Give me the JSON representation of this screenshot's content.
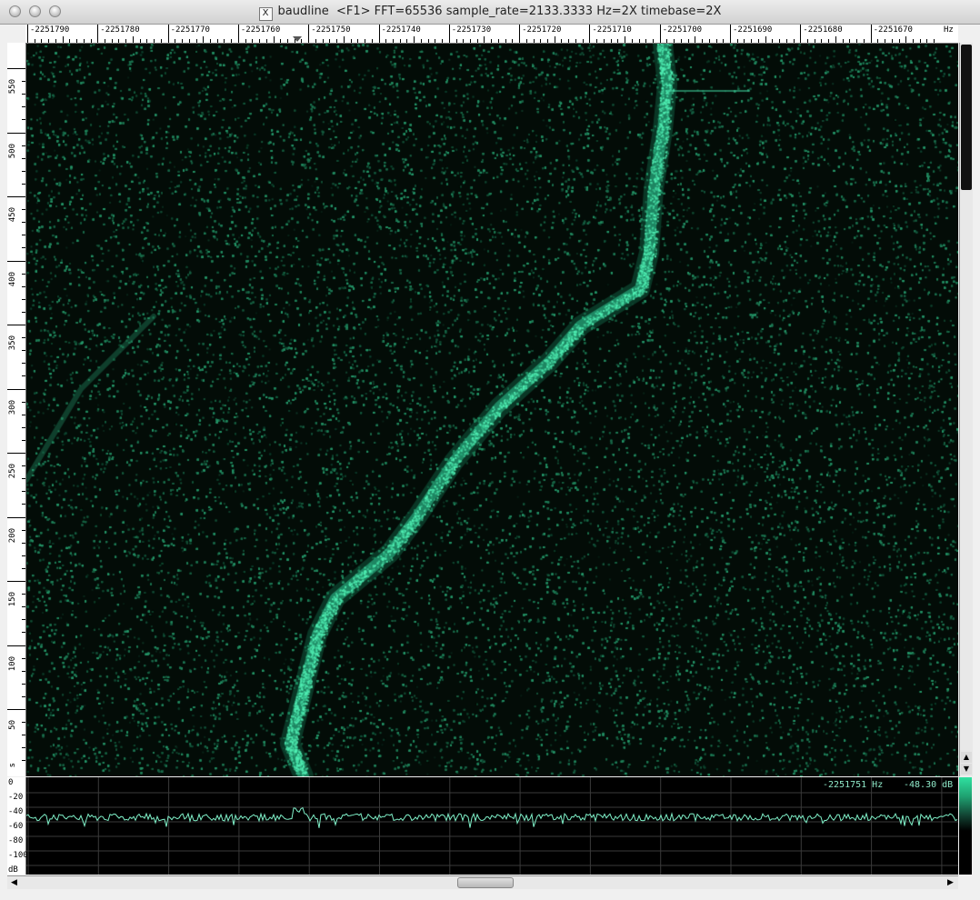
{
  "window": {
    "app_name": "baudline",
    "title_info": "<F1> FFT=65536 sample_rate=2133.3333 Hz=2X timebase=2X",
    "icon": "x11-icon"
  },
  "frequency_axis": {
    "unit": "Hz",
    "labels": [
      "-2251790",
      "-2251780",
      "-2251770",
      "-2251760",
      "-2251750",
      "-2251740",
      "-2251730",
      "-2251720",
      "-2251710",
      "-2251700",
      "-2251690",
      "-2251680",
      "-2251670"
    ]
  },
  "time_axis": {
    "labels": [
      "550",
      "500",
      "450",
      "400",
      "350",
      "300",
      "250",
      "200",
      "150",
      "100",
      "50"
    ],
    "unit_label": "s"
  },
  "spectrum": {
    "db_labels": [
      "0",
      "-20",
      "-40",
      "-60",
      "-80",
      "-100",
      "dB"
    ],
    "cursor_freq": "-2251751 Hz",
    "cursor_db": "-48.30 dB",
    "trace_color": "#7ff0c8"
  },
  "colors": {
    "spectrogram_bg": "#041008",
    "signal": "#3fe0a8",
    "noise": "#1f7a58"
  }
}
